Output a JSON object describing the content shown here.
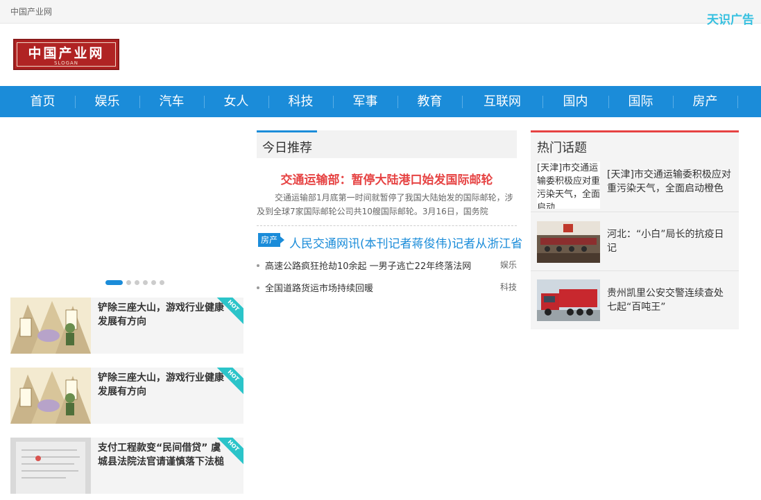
{
  "topbar": {
    "site_name": "中国产业网",
    "ad_text": "天识广告"
  },
  "logo": {
    "title": "中国产业网",
    "slogan": "SLOGAN"
  },
  "nav": {
    "items": [
      "首页",
      "娱乐",
      "汽车",
      "女人",
      "科技",
      "军事",
      "教育",
      "互联网",
      "国内",
      "国际",
      "房产"
    ]
  },
  "slider": {
    "dot_count": 6,
    "active_index": 0
  },
  "cards": [
    {
      "title": "铲除三座大山，游戏行业健康发展有方向",
      "badge": "HOT",
      "image_kind": "cartoon"
    },
    {
      "title": "铲除三座大山，游戏行业健康发展有方向",
      "badge": "HOT",
      "image_kind": "cartoon"
    },
    {
      "title": "支付工程款变“民间借贷” 虞城县法院法官请谨慎落下法槌",
      "badge": "HOT",
      "image_kind": "document"
    }
  ],
  "today": {
    "heading": "今日推荐",
    "headline": "交通运输部：暂停大陆港口始发国际邮轮",
    "summary": "交通运输部1月底第一时间就暂停了我国大陆始发的国际邮轮，涉及到全球7家国际邮轮公司共10艘国际邮轮。3月16日，国务院",
    "tag": "房产",
    "lead": "人民交通网讯(本刊记者蒋俊伟)记者从浙江省",
    "list": [
      {
        "title": "高速公路疯狂抢劫10余起 一男子逃亡22年终落法网",
        "category": "娱乐"
      },
      {
        "title": "全国道路货运市场持续回暖",
        "category": "科技"
      }
    ]
  },
  "hot_topics": {
    "heading": "热门话题",
    "items": [
      {
        "image_alt": "[天津]市交通运输委积极应对重污染天气，全面启动",
        "text": "[天津]市交通运输委积极应对重污染天气，全面启动橙色"
      },
      {
        "text": "河北：“小白”局长的抗疫日记"
      },
      {
        "text": "贵州凯里公安交警连续查处七起“百吨王”"
      }
    ]
  },
  "colors": {
    "nav_blue": "#1b8cd9",
    "headline_red": "#e64343",
    "hot_teal": "#2bc4c9",
    "ad_cyan": "#35c0e0"
  }
}
